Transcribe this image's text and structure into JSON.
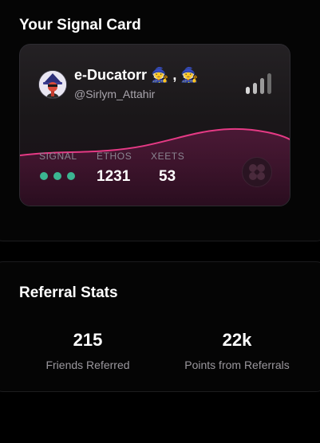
{
  "signal_card_section": {
    "title": "Your Signal Card"
  },
  "profile": {
    "display_name": "e-Ducatorr 🧙 , 🧙",
    "handle": "@Sirlym_Attahir"
  },
  "stats": {
    "signal_label": "SIGNAL",
    "signal_level": 3,
    "ethos_label": "ETHOS",
    "ethos_value": "1231",
    "xeets_label": "XEETS",
    "xeets_value": "53"
  },
  "icons": {
    "signal_strength": "signal-bars-icon",
    "brand": "brand-logo-icon",
    "avatar": "avatar-image"
  },
  "colors": {
    "wave": "#e53a85",
    "signal_dot": "#3bb591",
    "background": "#000000"
  },
  "referral_section": {
    "title": "Referral Stats",
    "friends_referred_value": "215",
    "friends_referred_label": "Friends Referred",
    "points_value": "22k",
    "points_label": "Points from Referrals"
  }
}
